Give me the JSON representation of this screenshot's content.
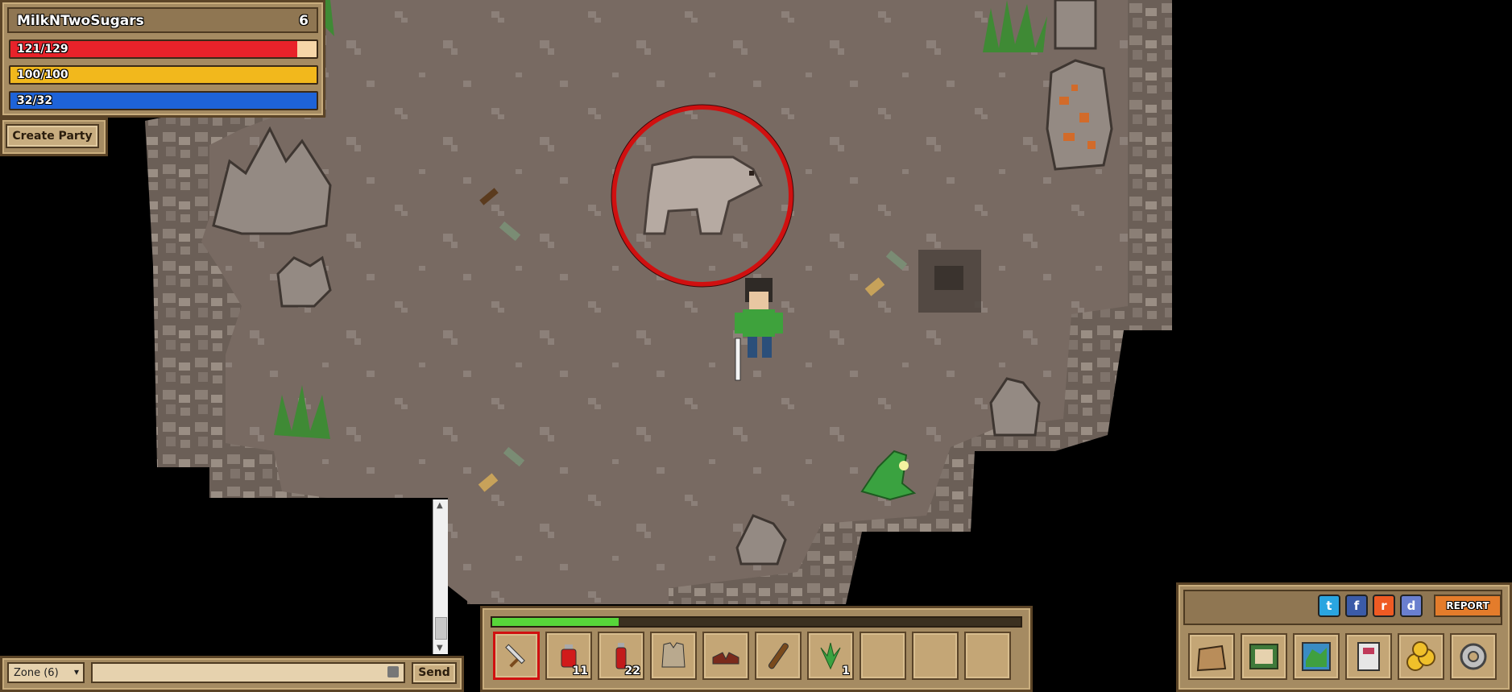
{
  "player": {
    "name": "MilkNTwoSugars",
    "level": "6",
    "hp": {
      "text": "121/129",
      "value": 121,
      "max": 129,
      "color": "#e8222a"
    },
    "energy": {
      "text": "100/100",
      "value": 100,
      "max": 100,
      "color": "#f2b81c"
    },
    "mana": {
      "text": "32/32",
      "value": 32,
      "max": 32,
      "color": "#1e63d8"
    }
  },
  "party": {
    "create_label": "Create Party"
  },
  "chat": {
    "zone_label": "Zone (6)",
    "zone_arrow": "▾",
    "input_placeholder": "",
    "send_label": "Send"
  },
  "hotbar": {
    "xp_fraction": 0.24,
    "slots": [
      {
        "icon": "sword-icon",
        "count": "",
        "selected": true
      },
      {
        "icon": "health-potion-icon",
        "count": "11",
        "selected": false
      },
      {
        "icon": "mana-potion-icon",
        "count": "22",
        "selected": false
      },
      {
        "icon": "cloth-armor-icon",
        "count": "",
        "selected": false
      },
      {
        "icon": "boots-icon",
        "count": "",
        "selected": false
      },
      {
        "icon": "wooden-club-icon",
        "count": "",
        "selected": false
      },
      {
        "icon": "herb-icon",
        "count": "1",
        "selected": false
      },
      {
        "icon": "empty-slot",
        "count": "",
        "selected": false
      },
      {
        "icon": "empty-slot",
        "count": "",
        "selected": false
      },
      {
        "icon": "empty-slot",
        "count": "",
        "selected": false
      }
    ]
  },
  "social": {
    "twitter": "t",
    "facebook": "f",
    "reddit": "r",
    "discord": "d",
    "report_label": "REPORT"
  },
  "menu": {
    "icons": [
      "inventory-bag-icon",
      "quest-book-icon",
      "world-map-icon",
      "character-icon",
      "gold-coins-icon",
      "settings-gear-icon"
    ]
  },
  "scene": {
    "target": "bear",
    "colors": {
      "ground": "#7a6b63",
      "rock": "#8a8079",
      "void": "#000000",
      "target_ring": "#d01010"
    }
  }
}
